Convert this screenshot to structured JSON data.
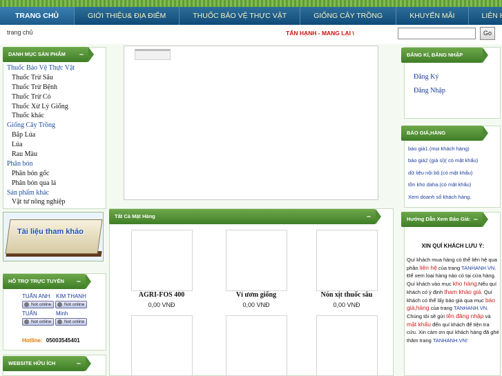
{
  "nav": {
    "items": [
      "TRANG CHỦ",
      "GIỚI THIỆU& ĐỊA ĐIỂM",
      "THUỐC BẢO VỆ THỰC VẬT",
      "GIỐNG CÂY TRỒNG",
      "KHUYẾN MÃI",
      "LIÊN HỆ"
    ]
  },
  "topbar": {
    "breadcrumb": "trang chủ",
    "marquee": "TẤN HẠNH - MANG LẠI \\",
    "search_placeholder": "",
    "go_label": "Go"
  },
  "left": {
    "categories_title": "DANH MỤC SẢN PHẨM",
    "categories": [
      {
        "label": "Thuốc Bảo Vệ Thực Vật",
        "level": 0
      },
      {
        "label": "Thuốc Trừ Sâu",
        "level": 1
      },
      {
        "label": "Thuốc Trừ Bệnh",
        "level": 1
      },
      {
        "label": "Thuốc Trừ Cỏ",
        "level": 1
      },
      {
        "label": "Thuốc Xử Lý Giống",
        "level": 1
      },
      {
        "label": "Thuốc khác",
        "level": 1
      },
      {
        "label": "Giống Cây Trồng",
        "level": 0
      },
      {
        "label": "Bắp Lúa",
        "level": 1
      },
      {
        "label": "Lúa",
        "level": 1
      },
      {
        "label": "Rau Màu",
        "level": 1
      },
      {
        "label": "Phân bón",
        "level": 0
      },
      {
        "label": "Phân bón gốc",
        "level": 1
      },
      {
        "label": "Phân bón qua lá",
        "level": 1
      },
      {
        "label": "Sản phẩm khác",
        "level": 0
      },
      {
        "label": "Vật tư nông nghiệp",
        "level": 1
      }
    ],
    "reference_banner": "Tài liệu tham khảo",
    "support_title": "HỖ TRỢ TRỰC TUYẾN",
    "support": [
      {
        "first": "TUẤN ANH",
        "second": "KIM THANH",
        "status1": "Not online",
        "status2": "Not online"
      },
      {
        "first": "TUẤN",
        "second": "Minh",
        "status1": "Not online",
        "status2": "Not online"
      }
    ],
    "hotline_label": "Hotline:",
    "hotline_number": "05003545401",
    "links_title": "WEBSITE HỮU ÍCH"
  },
  "center": {
    "products_title": "Tất Cả Mặt Hàng",
    "products": [
      {
        "name": "AGRI-FOS 400",
        "price": "0,00 VNĐ"
      },
      {
        "name": "Vỉ ươm giống",
        "price": "0,00 VNĐ"
      },
      {
        "name": "Nón xịt thuốc sâu",
        "price": "0,00 VNĐ"
      }
    ]
  },
  "right": {
    "account_title": "ĐĂNG KÍ, ĐĂNG NHẬP",
    "register": "Đăng Ký",
    "login": "Đăng Nhập",
    "price_title": "BÁO GIÁ,HÀNG",
    "price_links": [
      "báo giá1.(mọi khách hàng)",
      "báo giá2 (giá sỉ)( có mật khẩu)",
      "dữ liệu nội bộ.(có mật khẩu)",
      "tồn kho daha.(có mật khẩu)",
      "Xem doanh số khách hàng."
    ],
    "guide_title": "Hướng Dẫn Xem Báo Giá:",
    "notice_head": "XIN QUÍ KHÁCH LƯU Ý:",
    "notice": {
      "p1": "Quí khách mua hàng có thể liên hệ qua phần ",
      "p1_link": "liên hệ",
      "p2": " của trang ",
      "site": "TANHANH.VN",
      "p3": ". Để xem loại hàng nào có tại cửa hàng. Quí khách vào mục ",
      "kho": "kho hàng",
      "p4": ".Nếu quí khách có ý định ",
      "tham_khao": "tham khảo giá",
      "p5": ". Quí khách có thể lấy báo giá qua mục ",
      "bao_gia": "báo giá,hàng",
      "p6": " của trang ",
      "p7": ". Chúng tôi sẽ gửi ",
      "ten_dang_nhap": "tên đăng nhập",
      "p8": " và ",
      "mat_khau": "mật khẩu",
      "p9": " đến quí khách để tiện tra cứu. Xin cảm ơn quí khách hàng đã ghé thăm trang ",
      "site_end": "TANHANH.VN!"
    }
  }
}
